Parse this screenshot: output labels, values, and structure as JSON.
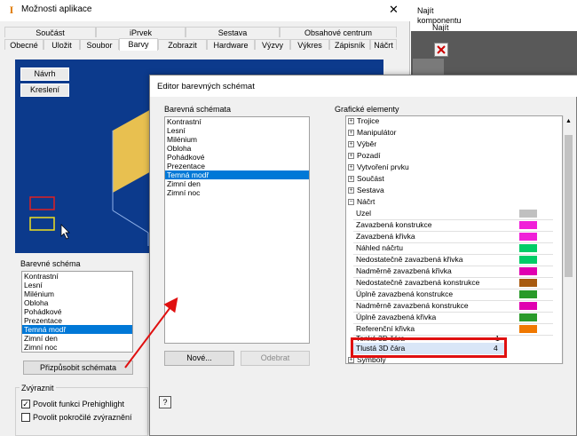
{
  "options_dialog": {
    "title": "Možnosti aplikace",
    "close_glyph": "✕",
    "tabs_row1": [
      "Součást",
      "iPrvek",
      "Sestava",
      "Obsahové centrum"
    ],
    "tabs_row2": [
      "Obecné",
      "Uložit",
      "Soubor",
      "Barvy",
      "Zobrazit",
      "Hardware",
      "Výzvy",
      "Výkres",
      "Zápisník",
      "Náčrt"
    ],
    "selected_tab": "Barvy",
    "preview_buttons": [
      "Návrh",
      "Kreslení"
    ],
    "scheme_group_label": "Barevné schéma",
    "schemes": [
      "Kontrastní",
      "Lesní",
      "Milénium",
      "Obloha",
      "Pohádkové",
      "Prezentace",
      "Temná modř",
      "Zimní den",
      "Zimní noc"
    ],
    "selected_scheme": "Temná modř",
    "customize_button": "Přizpůsobit schémata",
    "highlight_group_label": "Zvýraznit",
    "prehighlight_label": "Povolit funkci Prehighlight",
    "advanced_highlight_label": "Povolit pokročilé zvýraznění"
  },
  "right_strip": {
    "find_component": "Najít komponentu",
    "find": "Najít"
  },
  "editor": {
    "title": "Editor barevných schémat",
    "schemes_label": "Barevná schémata",
    "schemes": [
      "Kontrastní",
      "Lesní",
      "Milénium",
      "Obloha",
      "Pohádkové",
      "Prezentace",
      "Temná modř",
      "Zimní den",
      "Zimní noc"
    ],
    "selected_scheme": "Temná modř",
    "new_button": "Nové...",
    "remove_button": "Odebrat",
    "help_glyph": "?",
    "graphics_label": "Grafické elementy",
    "collapsed_groups": [
      "Trojice",
      "Manipulátor",
      "Výběr",
      "Pozadí",
      "Vytvoření prvku",
      "Součást",
      "Sestava"
    ],
    "expanded_group": "Náčrt",
    "sketch_items": [
      {
        "label": "Uzel",
        "color": "#c0c0c0"
      },
      {
        "label": "Zavazbená konstrukce",
        "color": "#f020d8"
      },
      {
        "label": "Zavazbená křivka",
        "color": "#f020d8"
      },
      {
        "label": "Náhled náčrtu",
        "color": "#00cc66"
      },
      {
        "label": "Nedostatečně zavazbená křivka",
        "color": "#00cc66"
      },
      {
        "label": "Nadměrně zavazbená křivka",
        "color": "#e000b0"
      },
      {
        "label": "Nedostatečně zavazbená konstrukce",
        "color": "#a85a10"
      },
      {
        "label": "Úplně zavazbená konstrukce",
        "color": "#2a9a2a"
      },
      {
        "label": "Nadměrně zavazbená konstrukce",
        "color": "#e000b0"
      },
      {
        "label": "Úplně zavazbená křivka",
        "color": "#2a9a2a"
      },
      {
        "label": "Referenční křivka",
        "color": "#f07800"
      }
    ],
    "thin_line_label": "Tenká 3D čára",
    "thin_line_value": "1",
    "thick_line_label": "Tlustá 3D čára",
    "thick_line_value": "4",
    "last_group": "Symboly"
  }
}
